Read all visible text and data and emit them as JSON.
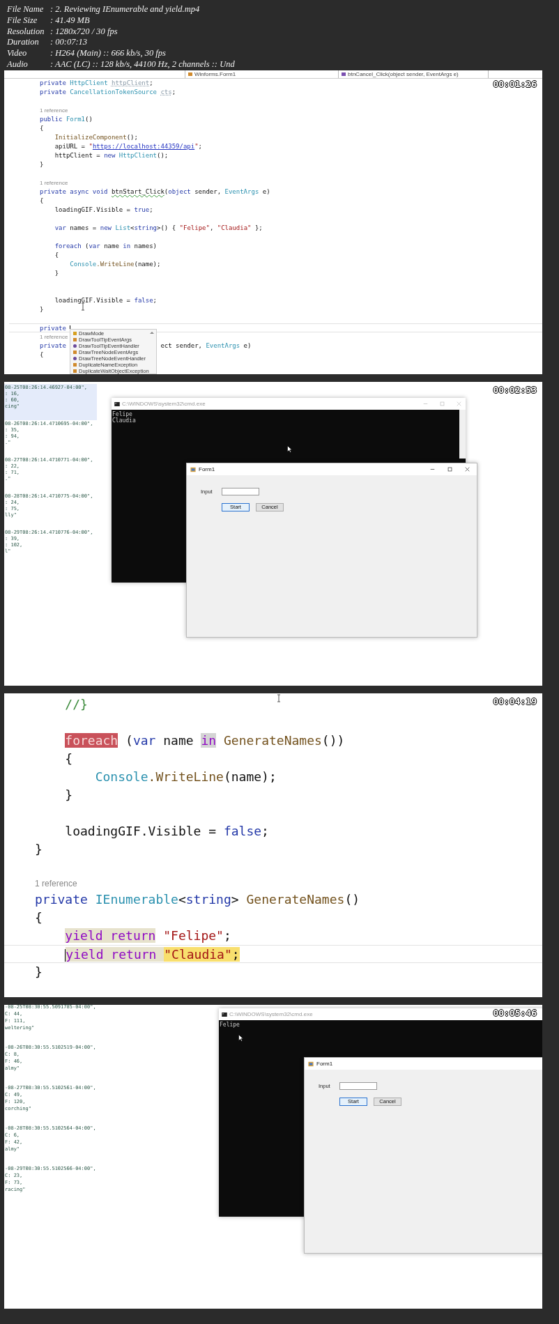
{
  "video_info": [
    {
      "label": "File Name",
      "value": ":  2. Reviewing IEnumerable and yield.mp4"
    },
    {
      "label": "File Size",
      "value": ":  41.49 MB"
    },
    {
      "label": "Resolution",
      "value": ":  1280x720 / 30 fps"
    },
    {
      "label": "Duration",
      "value": ":  00:07:13"
    },
    {
      "label": "Video",
      "value": ":  H264 (Main) :: 666 kb/s, 30 fps"
    },
    {
      "label": "Audio",
      "value": ":  AAC (LC) :: 128 kb/s, 44100 Hz, 2 channels :: Und"
    }
  ],
  "frames": [
    {
      "kind": "code-editor",
      "timestamp": "00:01:26",
      "navigation_bar": [
        {
          "text": "Winforms.Form1",
          "kind": "class"
        },
        {
          "text": "btnCancel_Click(object sender, EventArgs e)",
          "kind": "method"
        }
      ],
      "lines": [
        {
          "kind": "code",
          "tokens": [
            {
              "text": "private ",
              "kind": "keyword"
            },
            {
              "text": "HttpClient ",
              "kind": "type"
            },
            {
              "text": "httpClient",
              "kind": "faded"
            },
            {
              "text": ";",
              "kind": "plain"
            }
          ]
        },
        {
          "kind": "code",
          "tokens": [
            {
              "text": "private ",
              "kind": "keyword"
            },
            {
              "text": "CancellationTokenSource ",
              "kind": "type"
            },
            {
              "text": "cts",
              "kind": "faded"
            },
            {
              "text": ";",
              "kind": "plain"
            }
          ]
        },
        {
          "kind": "blank"
        },
        {
          "kind": "reference",
          "text": "1 reference"
        },
        {
          "kind": "code",
          "tokens": [
            {
              "text": "public ",
              "kind": "keyword"
            },
            {
              "text": "Form1",
              "kind": "type"
            },
            {
              "text": "()",
              "kind": "plain"
            }
          ]
        },
        {
          "kind": "code",
          "tokens": [
            {
              "text": "{",
              "kind": "plain"
            }
          ],
          "children": [
            {
              "kind": "code",
              "tokens": [
                {
                  "text": "InitializeComponent",
                  "kind": "method"
                },
                {
                  "text": "();",
                  "kind": "plain"
                }
              ]
            },
            {
              "kind": "code",
              "tokens": [
                {
                  "text": "apiURL = ",
                  "kind": "plain"
                },
                {
                  "text": "\"",
                  "kind": "string"
                },
                {
                  "text": "https://localhost:44359/api",
                  "kind": "link"
                },
                {
                  "text": "\"",
                  "kind": "string"
                },
                {
                  "text": ";",
                  "kind": "plain"
                }
              ]
            },
            {
              "kind": "code",
              "tokens": [
                {
                  "text": "httpClient = ",
                  "kind": "plain"
                },
                {
                  "text": "new ",
                  "kind": "keyword"
                },
                {
                  "text": "HttpClient",
                  "kind": "type"
                },
                {
                  "text": "();",
                  "kind": "plain"
                }
              ]
            }
          ]
        },
        {
          "kind": "code",
          "tokens": [
            {
              "text": "}",
              "kind": "plain"
            }
          ]
        },
        {
          "kind": "blank"
        },
        {
          "kind": "reference",
          "text": "1 reference"
        },
        {
          "kind": "code",
          "tokens": [
            {
              "text": "private async void ",
              "kind": "keyword"
            },
            {
              "text": "btnStart_Click",
              "kind": "warning"
            },
            {
              "text": "(",
              "kind": "plain"
            },
            {
              "text": "object",
              "kind": "keyword"
            },
            {
              "text": " sender, ",
              "kind": "plain"
            },
            {
              "text": "EventArgs",
              "kind": "type"
            },
            {
              "text": " e)",
              "kind": "plain"
            }
          ]
        },
        {
          "kind": "code",
          "tokens": [
            {
              "text": "{",
              "kind": "plain"
            }
          ],
          "children": [
            {
              "kind": "code",
              "tokens": [
                {
                  "text": "loadingGIF.Visible = ",
                  "kind": "plain"
                },
                {
                  "text": "true",
                  "kind": "keyword"
                },
                {
                  "text": ";",
                  "kind": "plain"
                }
              ]
            },
            {
              "kind": "blank"
            },
            {
              "kind": "code",
              "tokens": [
                {
                  "text": "var",
                  "kind": "keyword"
                },
                {
                  "text": " names = ",
                  "kind": "plain"
                },
                {
                  "text": "new ",
                  "kind": "keyword"
                },
                {
                  "text": "List",
                  "kind": "type"
                },
                {
                  "text": "<",
                  "kind": "plain"
                },
                {
                  "text": "string",
                  "kind": "keyword"
                },
                {
                  "text": ">() { ",
                  "kind": "plain"
                },
                {
                  "text": "\"Felipe\"",
                  "kind": "string"
                },
                {
                  "text": ", ",
                  "kind": "plain"
                },
                {
                  "text": "\"Claudia\"",
                  "kind": "string"
                },
                {
                  "text": " };",
                  "kind": "plain"
                }
              ]
            },
            {
              "kind": "blank"
            },
            {
              "kind": "code",
              "tokens": [
                {
                  "text": "foreach",
                  "kind": "keyword"
                },
                {
                  "text": " (",
                  "kind": "plain"
                },
                {
                  "text": "var",
                  "kind": "keyword"
                },
                {
                  "text": " name ",
                  "kind": "plain"
                },
                {
                  "text": "in",
                  "kind": "keyword"
                },
                {
                  "text": " names)",
                  "kind": "plain"
                }
              ]
            },
            {
              "kind": "code",
              "tokens": [
                {
                  "text": "{",
                  "kind": "plain"
                }
              ],
              "children": [
                {
                  "kind": "code",
                  "tokens": [
                    {
                      "text": "Console",
                      "kind": "type"
                    },
                    {
                      "text": ".WriteLine",
                      "kind": "method"
                    },
                    {
                      "text": "(name);",
                      "kind": "plain"
                    }
                  ]
                }
              ]
            },
            {
              "kind": "code",
              "tokens": [
                {
                  "text": "}",
                  "kind": "plain"
                }
              ]
            },
            {
              "kind": "blank"
            },
            {
              "kind": "blank"
            },
            {
              "kind": "code",
              "tokens": [
                {
                  "text": "loadingGIF.Visible = ",
                  "kind": "plain"
                },
                {
                  "text": "false",
                  "kind": "keyword"
                },
                {
                  "text": ";",
                  "kind": "plain"
                }
              ]
            }
          ]
        },
        {
          "kind": "code",
          "tokens": [
            {
              "text": "}",
              "kind": "plain"
            }
          ]
        },
        {
          "kind": "blank"
        },
        {
          "kind": "code",
          "current": true,
          "tokens": [
            {
              "text": "private ",
              "kind": "keyword",
              "caret_after": true
            }
          ]
        },
        {
          "kind": "reference",
          "text": "1 reference"
        },
        {
          "kind": "code",
          "covered": true,
          "tokens": [
            {
              "text": "private",
              "kind": "keyword"
            },
            {
              "text": "ect sender, ",
              "kind": "plain"
            },
            {
              "text": "EventArgs",
              "kind": "type"
            },
            {
              "text": " e)",
              "kind": "plain"
            }
          ]
        },
        {
          "kind": "code",
          "tokens": [
            {
              "text": "{",
              "kind": "plain"
            }
          ]
        }
      ],
      "completion_list": [
        {
          "text": "DrawMode",
          "kind": "enum"
        },
        {
          "text": "DrawToolTipEventArgs",
          "kind": "class"
        },
        {
          "text": "DrawToolTipEventHandler",
          "kind": "delegate"
        },
        {
          "text": "DrawTreeNodeEventArgs",
          "kind": "class"
        },
        {
          "text": "DrawTreeNodeEventHandler",
          "kind": "delegate"
        },
        {
          "text": "DuplicateNameException",
          "kind": "class"
        },
        {
          "text": "DuplicateWaitObjectException",
          "kind": "class"
        }
      ]
    },
    {
      "kind": "desktop",
      "timestamp": "00:02:53",
      "json_text": [
        {
          "selected": true,
          "lines": [
            "08-25T08:26:14.46927-04:00\",",
            ": 16,",
            ": 60,",
            "cing\""
          ]
        },
        {
          "selected": false,
          "lines": [
            "08-26T08:26:14.4710695-04:00\",",
            ": 35,",
            ": 94,",
            ".\""
          ]
        },
        {
          "selected": false,
          "lines": [
            "08-27T08:26:14.4710771-04:00\",",
            ": 22,",
            ": 71,",
            ".\""
          ]
        },
        {
          "selected": false,
          "lines": [
            "08-28T08:26:14.4710775-04:00\",",
            ": 24,",
            ": 75,",
            "lly\""
          ]
        },
        {
          "selected": false,
          "lines": [
            "08-29T08:26:14.4710776-04:00\",",
            ": 39,",
            ": 102,",
            "l\""
          ]
        }
      ],
      "console": {
        "title": "C:\\WINDOWS\\system32\\cmd.exe",
        "window_controls": true,
        "output": [
          "Felipe",
          "Claudia"
        ]
      },
      "form": {
        "title": "Form1",
        "window_controls": true,
        "input_label": "Input",
        "buttons": [
          {
            "label": "Start",
            "default": true
          },
          {
            "label": "Cancel",
            "default": false
          }
        ]
      }
    },
    {
      "kind": "code-zoomed",
      "timestamp": "00:04:19",
      "lines": [
        {
          "kind": "group",
          "children": [
            {
              "kind": "code",
              "tokens": [
                {
                  "text": "//}",
                  "kind": "comment"
                }
              ]
            },
            {
              "kind": "blank"
            },
            {
              "kind": "code",
              "tokens": [
                {
                  "text": "foreach",
                  "kind": "keyword",
                  "error": true
                },
                {
                  "text": " (",
                  "kind": "plain"
                },
                {
                  "text": "var",
                  "kind": "keyword"
                },
                {
                  "text": " name ",
                  "kind": "plain"
                },
                {
                  "text": "in",
                  "kind": "control",
                  "match": true
                },
                {
                  "text": " GenerateNames",
                  "kind": "method"
                },
                {
                  "text": "())",
                  "kind": "plain"
                }
              ]
            },
            {
              "kind": "code",
              "tokens": [
                {
                  "text": "{",
                  "kind": "plain"
                }
              ],
              "children": [
                {
                  "kind": "code",
                  "tokens": [
                    {
                      "text": "Console",
                      "kind": "type"
                    },
                    {
                      "text": ".WriteLine",
                      "kind": "method"
                    },
                    {
                      "text": "(name);",
                      "kind": "plain"
                    }
                  ]
                }
              ]
            },
            {
              "kind": "code",
              "tokens": [
                {
                  "text": "}",
                  "kind": "plain"
                }
              ]
            },
            {
              "kind": "blank"
            },
            {
              "kind": "code",
              "tokens": [
                {
                  "text": "loadingGIF.Visible = ",
                  "kind": "plain"
                },
                {
                  "text": "false",
                  "kind": "keyword"
                },
                {
                  "text": ";",
                  "kind": "plain"
                }
              ]
            }
          ]
        },
        {
          "kind": "code",
          "tokens": [
            {
              "text": "}",
              "kind": "plain"
            }
          ]
        },
        {
          "kind": "blank"
        },
        {
          "kind": "reference",
          "text": "1 reference"
        },
        {
          "kind": "code",
          "tokens": [
            {
              "text": "private ",
              "kind": "keyword"
            },
            {
              "text": "IEnumerable",
              "kind": "type"
            },
            {
              "text": "<",
              "kind": "plain"
            },
            {
              "text": "string",
              "kind": "keyword"
            },
            {
              "text": "> ",
              "kind": "plain"
            },
            {
              "text": "GenerateNames",
              "kind": "method"
            },
            {
              "text": "()",
              "kind": "plain"
            }
          ]
        },
        {
          "kind": "code",
          "tokens": [
            {
              "text": "{",
              "kind": "plain"
            }
          ],
          "children": [
            {
              "kind": "code",
              "tokens": [
                {
                  "text": "yield return",
                  "kind": "control",
                  "usage": true
                },
                {
                  "text": " \"Felipe\"",
                  "kind": "string"
                },
                {
                  "text": ";",
                  "kind": "plain"
                }
              ]
            },
            {
              "kind": "code",
              "current": true,
              "tokens": [
                {
                  "text": "yield return ",
                  "kind": "control",
                  "usage": true,
                  "caret_before": true
                },
                {
                  "text": "\"Claudia\"",
                  "kind": "string",
                  "selection": true
                },
                {
                  "text": ";",
                  "kind": "plain",
                  "selection": true
                }
              ]
            }
          ]
        },
        {
          "kind": "code",
          "tokens": [
            {
              "text": "}",
              "kind": "plain"
            }
          ]
        }
      ]
    },
    {
      "kind": "desktop",
      "timestamp": "00:05:46",
      "json_text": [
        {
          "selected": false,
          "lines": [
            "-08-25T08:30:55.5091785-04:00\",",
            "C: 44,",
            "F: 111,",
            "weltering\""
          ]
        },
        {
          "selected": false,
          "lines": [
            "-08-26T08:30:55.5102519-04:00\",",
            "C: 8,",
            "F: 46,",
            "almy\""
          ]
        },
        {
          "selected": false,
          "lines": [
            "-08-27T08:30:55.5102561-04:00\",",
            "C: 49,",
            "F: 120,",
            "corching\""
          ]
        },
        {
          "selected": false,
          "lines": [
            "-08-28T08:30:55.5102564-04:00\",",
            "C: 6,",
            "F: 42,",
            "almy\""
          ]
        },
        {
          "selected": false,
          "lines": [
            "-08-29T08:30:55.5102566-04:00\",",
            "C: 23,",
            "F: 73,",
            "racing\""
          ]
        }
      ],
      "console": {
        "title": "C:\\WINDOWS\\system32\\cmd.exe",
        "window_controls": false,
        "output": [
          "Felipe"
        ]
      },
      "form": {
        "title": "Form1",
        "window_controls": false,
        "input_label": "Input",
        "buttons": [
          {
            "label": "Start",
            "default": true
          },
          {
            "label": "Cancel",
            "default": false
          }
        ]
      }
    }
  ]
}
